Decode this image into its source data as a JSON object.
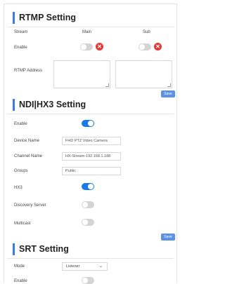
{
  "rtmp": {
    "title": "RTMP Setting",
    "stream_label": "Stream",
    "main_label": "Main",
    "sub_label": "Sub",
    "enable_label": "Enable",
    "address_label": "RTMP Address",
    "save_label": "Save",
    "main_enabled": false,
    "sub_enabled": false
  },
  "ndi": {
    "title": "NDI|HX3 Setting",
    "enable_label": "Enable",
    "enable_on": true,
    "device_name_label": "Device Name",
    "device_name_value": "FHD PTZ Video Camera",
    "channel_name_label": "Channel Name",
    "channel_name_value": "HX-Stream-192.168.1.188",
    "groups_label": "Groups",
    "groups_value": "Public",
    "hx3_label": "HX3",
    "hx3_on": true,
    "discovery_label": "Discovery Server",
    "discovery_on": false,
    "multicast_label": "Multicast",
    "multicast_on": false,
    "save_label": "Save"
  },
  "srt": {
    "title": "SRT Setting",
    "mode_label": "Mode",
    "mode_value": "Listener",
    "enable_label": "Enable",
    "enable_on": false
  },
  "colors": {
    "accent": "#1a7be8",
    "error": "#e53935",
    "button": "#5b92e5",
    "section_bar": "#3b7dd8"
  }
}
